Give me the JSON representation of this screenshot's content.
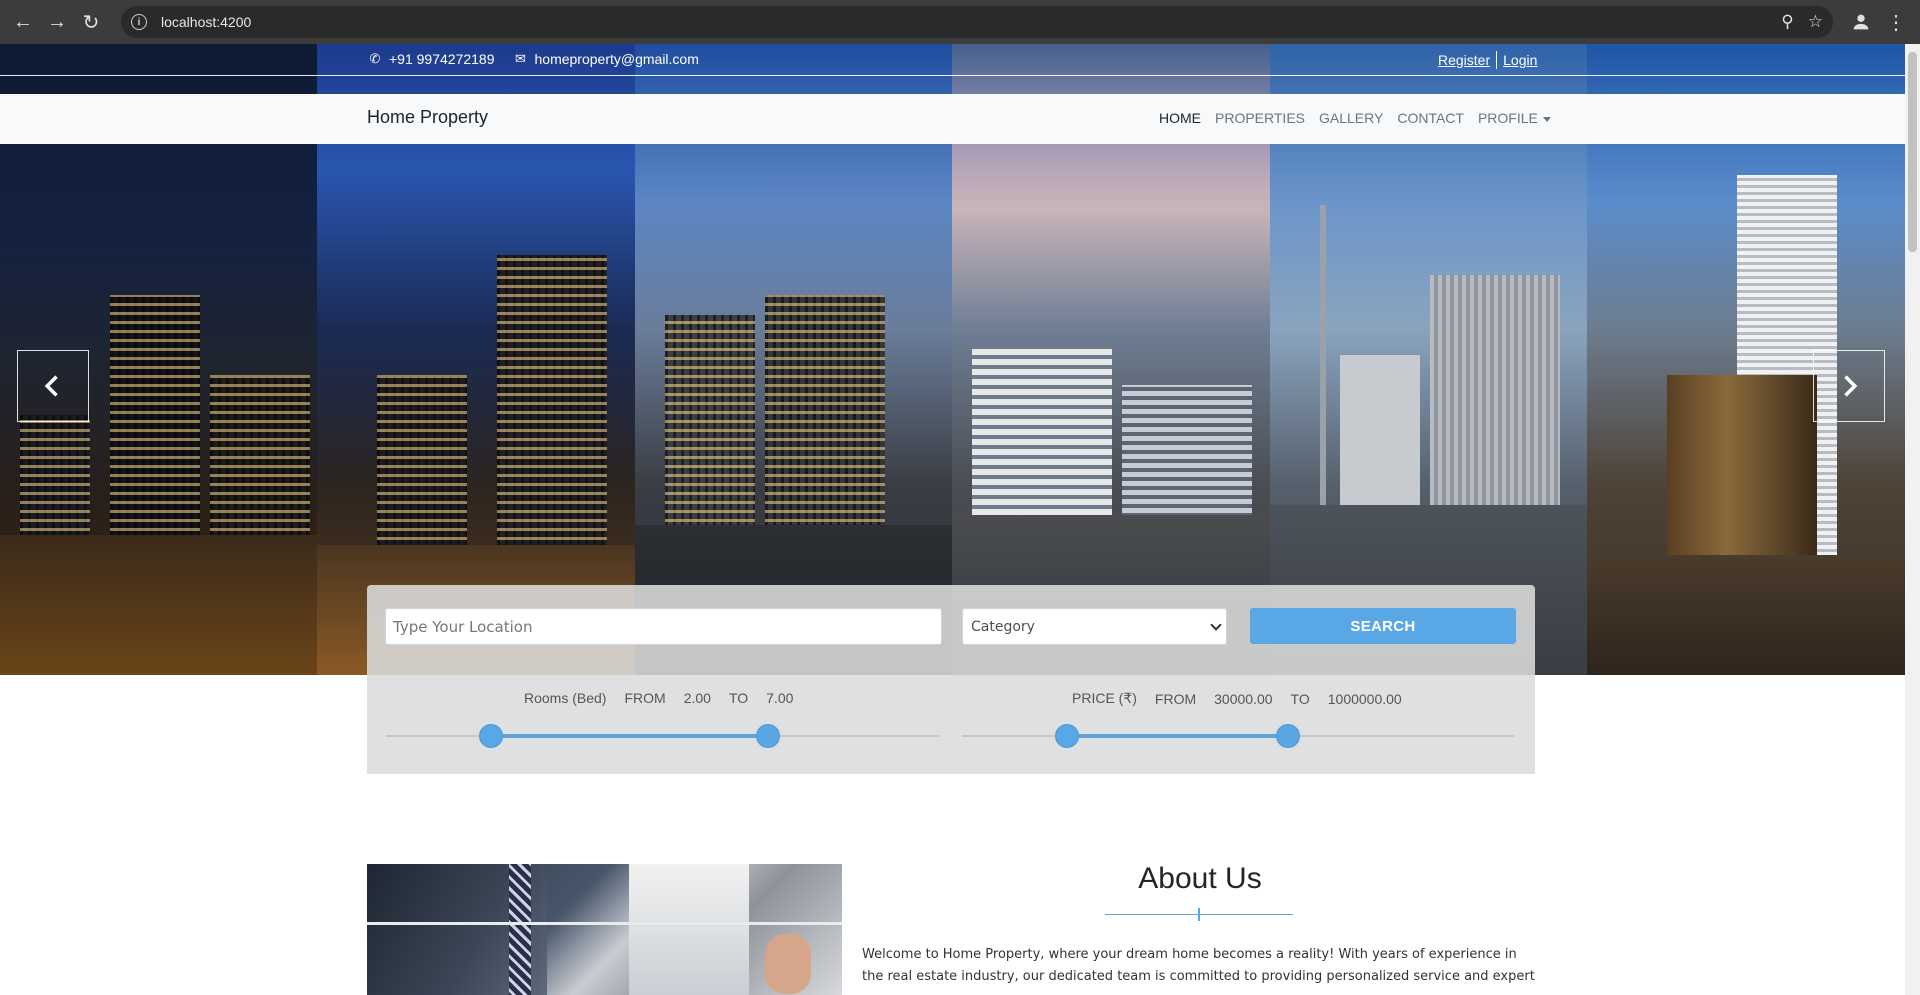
{
  "browser": {
    "url": "localhost:4200"
  },
  "topbar": {
    "phone": "+91 9974272189",
    "email": "homeproperty@gmail.com",
    "register": "Register",
    "login": "Login"
  },
  "navbar": {
    "brand": "Home Property",
    "links": [
      "HOME",
      "PROPERTIES",
      "GALLERY",
      "CONTACT",
      "PROFILE"
    ],
    "active": "HOME"
  },
  "search": {
    "location_placeholder": "Type Your Location",
    "category_selected": "Category",
    "search_label": "SEARCH"
  },
  "rooms_filter": {
    "label": "Rooms (Bed)",
    "from_label": "FROM",
    "from_value": "2.00",
    "to_label": "TO",
    "to_value": "7.00",
    "min_fraction": 0.19,
    "max_fraction": 0.69
  },
  "price_filter": {
    "label": "PRICE (₹)",
    "from_label": "FROM",
    "from_value": "30000.00",
    "to_label": "TO",
    "to_value": "1000000.00",
    "min_fraction": 0.19,
    "max_fraction": 0.59
  },
  "about": {
    "title": "About Us",
    "text": "Welcome to Home Property, where your dream home becomes a reality! With years of experience in the real estate industry, our dedicated team is committed to providing personalized service and expert"
  },
  "icons": {
    "back": "arrow-left-icon",
    "forward": "arrow-right-icon",
    "reload": "reload-icon",
    "zoom": "zoom-icon",
    "bookmark": "star-icon",
    "profile": "profile-icon",
    "menu": "kebab-menu-icon",
    "phone": "phone-icon",
    "email": "envelope-icon",
    "prev": "chevron-left-icon",
    "next": "chevron-right-icon"
  },
  "colors": {
    "accent": "#5aa7e6",
    "navbar_bg": "#f8f9fa",
    "chrome_bg": "#3c3c3c"
  }
}
